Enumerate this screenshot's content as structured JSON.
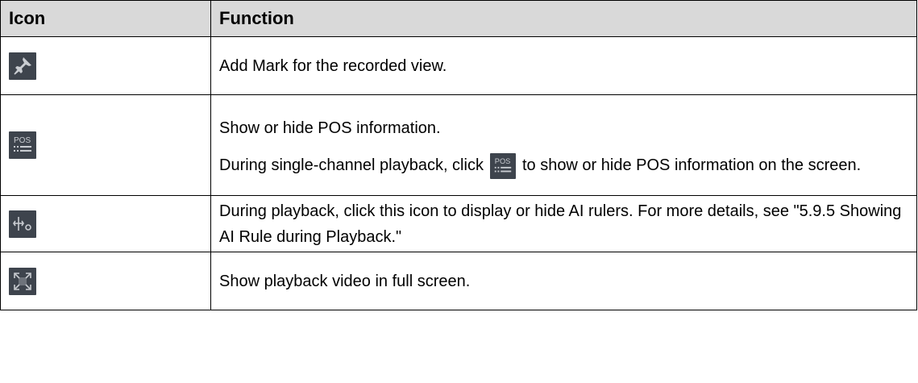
{
  "table": {
    "header": {
      "icon": "Icon",
      "function": "Function"
    },
    "rows": [
      {
        "icon": "pin-icon",
        "text": "Add Mark for the recorded view."
      },
      {
        "icon": "pos-icon",
        "line1": "Show or hide POS information.",
        "line2_before": "During single-channel playback, click",
        "inline_icon": "pos-icon",
        "line2_after": "to show or hide POS information on the screen."
      },
      {
        "icon": "ai-ruler-icon",
        "text": "During playback, click this icon to display or hide AI rulers. For more details, see \"5.9.5 Showing AI Rule during Playback.\""
      },
      {
        "icon": "fullscreen-icon",
        "text": "Show playback video in full screen."
      }
    ]
  },
  "colors": {
    "header_bg": "#d9d9d9",
    "icon_bg": "#3e444d",
    "icon_fg": "#c9ccd1"
  }
}
